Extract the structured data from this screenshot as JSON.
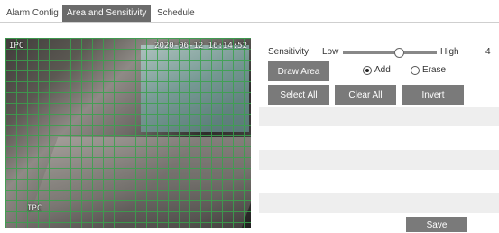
{
  "tabs": {
    "alarm_config": "Alarm Config",
    "area_and_sensitivity": "Area and Sensitivity",
    "schedule": "Schedule",
    "active_color": "#6b6b6b"
  },
  "video": {
    "osd_left": "IPC",
    "osd_right": "2020-06-12 16:14:52",
    "osd_bottom": "IPC"
  },
  "sensitivity": {
    "label": "Sensitivity",
    "low_label": "Low",
    "high_label": "High",
    "value": "4",
    "level_fraction": 0.6
  },
  "draw": {
    "draw_area_label": "Draw Area",
    "add_label": "Add",
    "erase_label": "Erase",
    "selected": "add"
  },
  "actions": {
    "select_all": "Select All",
    "clear_all": "Clear All",
    "invert": "Invert",
    "save": "Save"
  },
  "colors": {
    "grid": "#3aa24d",
    "button": "#7a7a7a",
    "stripe": "#eeeeee"
  }
}
